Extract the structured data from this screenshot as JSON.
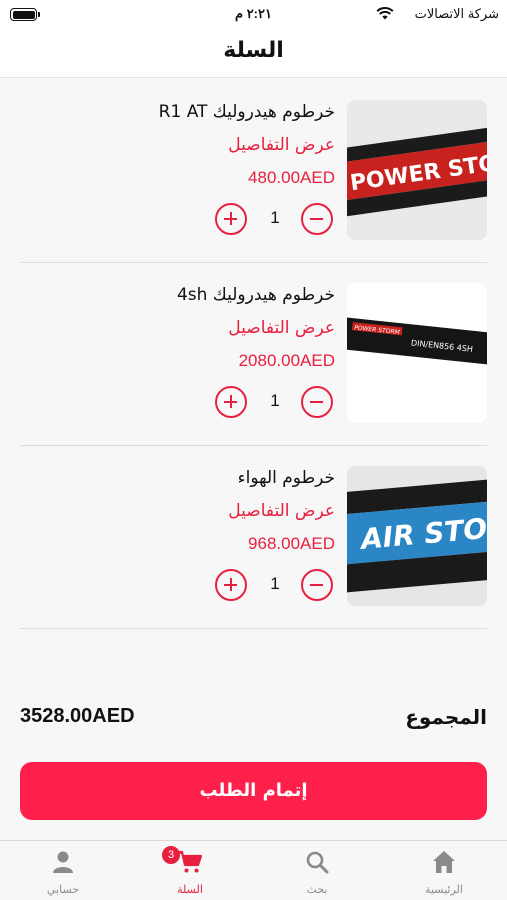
{
  "status_bar": {
    "carrier": "شركة الاتصالات",
    "time": "٢:٢١ م"
  },
  "header": {
    "title": "السلة"
  },
  "cart_items": [
    {
      "name": "خرطوم هيدروليك  R1 AT",
      "details_link": "عرض التفاصيل",
      "price": "480.00AED",
      "quantity": "1",
      "image_text": "POWER STOR"
    },
    {
      "name": "خرطوم هيدروليك 4sh",
      "details_link": "عرض التفاصيل",
      "price": "2080.00AED",
      "quantity": "1",
      "image_text": "POWER STORM   DIN/EN856 4SH"
    },
    {
      "name": "خرطوم الهواء",
      "details_link": "عرض التفاصيل",
      "price": "968.00AED",
      "quantity": "1",
      "image_text": "AIR STO"
    }
  ],
  "summary": {
    "total_label": "المجموع",
    "total_value": "3528.00AED"
  },
  "checkout": {
    "label": "إتمام الطلب"
  },
  "tabbar": {
    "home": "الرئيسية",
    "search": "بحث",
    "cart": "السلة",
    "cart_badge": "3",
    "account": "حسابي"
  },
  "colors": {
    "accent": "#e8203f",
    "button": "#ff1f4b"
  }
}
